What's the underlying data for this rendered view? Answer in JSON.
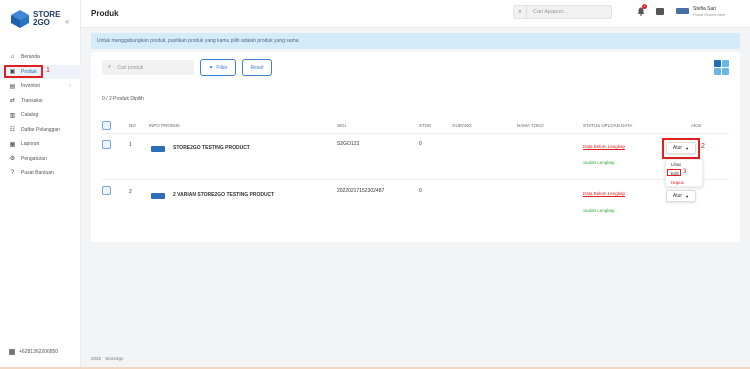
{
  "logo": {
    "line1": "STORE",
    "line2": "2GO"
  },
  "sidebar": {
    "collapse_icon": "double-chevron-left-icon",
    "items": [
      {
        "label": "Beranda",
        "icon": "home-icon"
      },
      {
        "label": "Produk",
        "icon": "box-icon"
      },
      {
        "label": "Inventori",
        "icon": "warehouse-icon"
      },
      {
        "label": "Transaksi",
        "icon": "swap-icon"
      },
      {
        "label": "Catalog",
        "icon": "catalog-icon"
      },
      {
        "label": "Daftar Pelanggan",
        "icon": "users-icon"
      },
      {
        "label": "Laporan",
        "icon": "report-icon"
      },
      {
        "label": "Pengaturan",
        "icon": "gear-icon"
      },
      {
        "label": "Pusat Bantuan",
        "icon": "help-icon"
      }
    ],
    "phone": "+6281362206850"
  },
  "annotations": {
    "n1": "1",
    "n2": "2",
    "n3": "3"
  },
  "header": {
    "title": "Produk",
    "search_placeholder": "Cari Apapun...",
    "notif_count": "1",
    "user_name": "Stefia Sari",
    "user_role": "Pusat Eksmember"
  },
  "banner": {
    "text": "Untuk menggabungkan produk, pastikan produk yang kamu pilih adalah produk yang sama"
  },
  "toolbar": {
    "search_placeholder": "Cari produk",
    "filter_label": "Filter",
    "reset_label": "Reset"
  },
  "count_text": "0 / 2 Produk Dipilih",
  "table": {
    "headers": {
      "no": "NO",
      "info": "INFO PRODUK",
      "sku": "SKU",
      "stok": "STOK",
      "gudang": "GUDANG",
      "nama_toko": "NAMA TOKO",
      "status": "STATUS UPLOAD DATA",
      "aksi": "AKSI"
    },
    "rows": [
      {
        "no": "1",
        "name": "STORE2GO TESTING PRODUCT",
        "sku": "S2GO123",
        "stok": "0",
        "status_link": "Data Belum Lengkap",
        "status_ok": "Sudah Lengkap",
        "aksi": "Atur"
      },
      {
        "no": "2",
        "name": "2 VARIAN STORE2GO TESTING PRODUCT",
        "sku": "20220217152302487",
        "stok": "0",
        "status_link": "Data Belum Lengkap",
        "status_ok": "Sudah Lengkap",
        "aksi": "Atur"
      }
    ]
  },
  "dropdown": {
    "items": [
      "Lihat",
      "Edit",
      "Hapus"
    ]
  },
  "footer": {
    "year": "2025",
    "brand": "Store2go"
  }
}
